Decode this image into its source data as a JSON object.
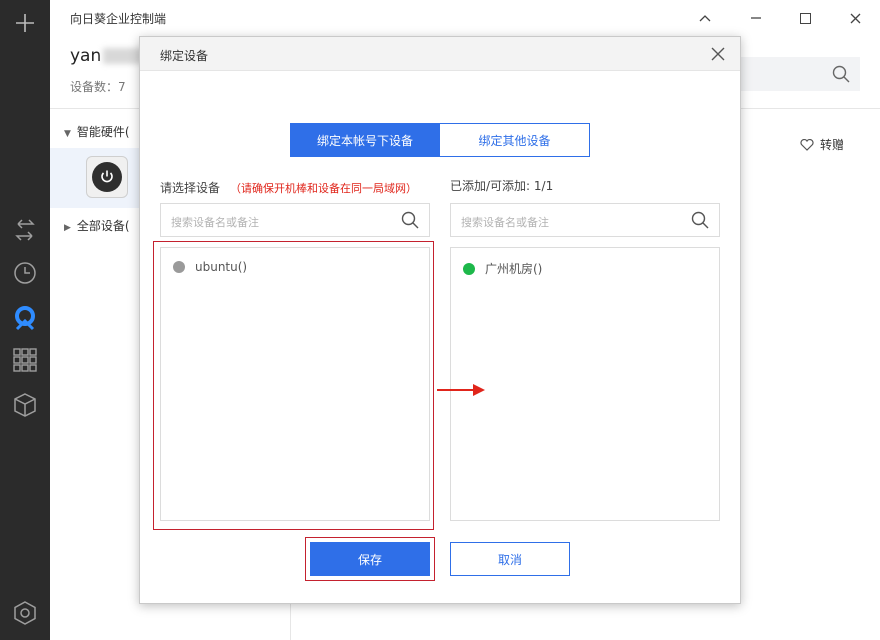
{
  "window": {
    "title": "向日葵企业控制端",
    "minimize_icon": "chevron-up-icon",
    "maximize_icon": "square-icon",
    "close_icon": "close-icon"
  },
  "rail": {
    "icons": [
      "plus-icon",
      "transfer-arrows-icon",
      "clock-icon",
      "sunflower-logo-icon",
      "apps-grid-icon",
      "cube-icon",
      "settings-hexagon-icon"
    ]
  },
  "account": {
    "username": "yan",
    "device_count": "设备数：7"
  },
  "tree": {
    "hardware_label": "智能硬件(",
    "all_devices_label": "全部设备("
  },
  "toolbar": {
    "gift_label": "转赠"
  },
  "modal": {
    "title": "绑定设备",
    "tabs": [
      {
        "label": "绑定本帐号下设备",
        "active": true
      },
      {
        "label": "绑定其他设备",
        "active": false
      }
    ],
    "select_label": "请选择设备",
    "select_warning": "（请确保开机棒和设备在同一局域网）",
    "added_label": "已添加/可添加:  1/1",
    "left_search_placeholder": "搜索设备名或备注",
    "right_search_placeholder": "搜索设备名或备注",
    "left_list": [
      {
        "name": "ubuntu()",
        "status_color": "#9a9a9a"
      }
    ],
    "right_list": [
      {
        "name": "广州机房()",
        "status_color": "#1db84a"
      }
    ],
    "save_label": "保存",
    "cancel_label": "取消"
  },
  "colors": {
    "accent": "#2f6fe8",
    "warning": "#e0251b",
    "annotation_red": "#c4212e",
    "rail_bg": "#2b2b2b"
  }
}
